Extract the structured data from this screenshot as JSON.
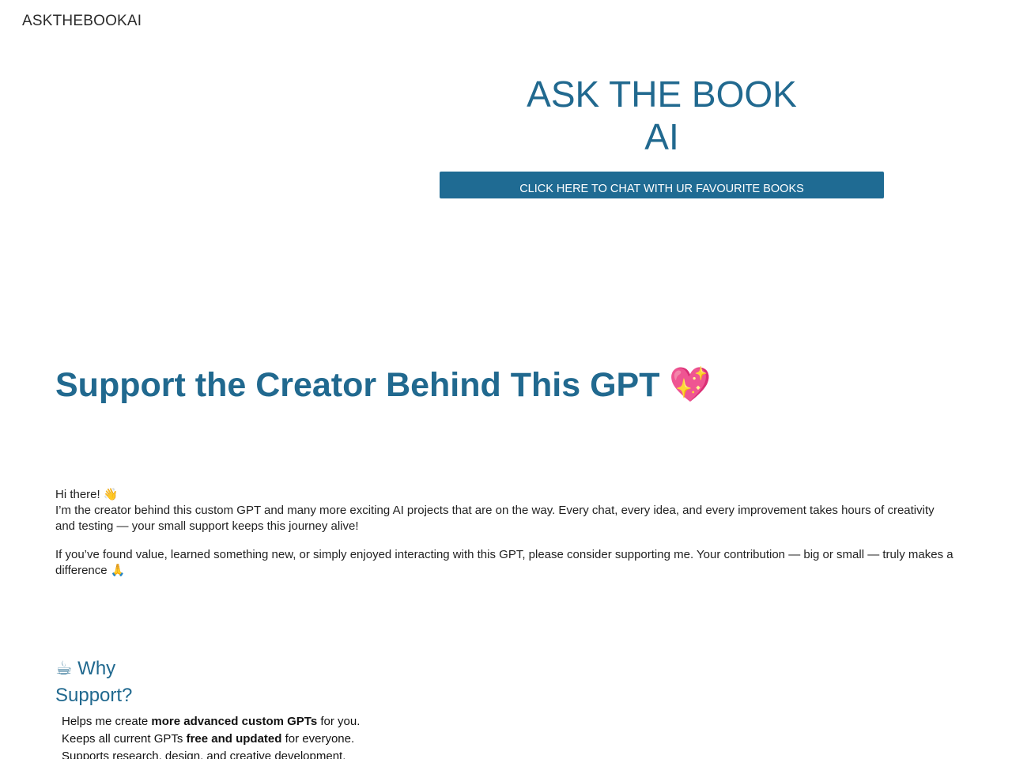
{
  "site": {
    "name": "ASKTHEBOOKAI"
  },
  "hero": {
    "title_line1": "ASK THE BOOK",
    "title_line2": "AI",
    "cta_label": "CLICK HERE TO CHAT WITH UR FAVOURITE BOOKS"
  },
  "support": {
    "heading": "Support the Creator Behind This GPT 💖",
    "greeting": "Hi there! 👋",
    "para1": "I’m the creator behind this custom GPT and many more exciting AI projects that are on the way. Every chat, every idea, and every improvement takes hours of creativity and testing — your small support keeps this journey alive!",
    "para2": "If you’ve found value, learned something new, or simply enjoyed interacting with this GPT, please consider supporting me. Your contribution — big or small — truly makes a difference 🙏"
  },
  "why": {
    "heading": "☕ Why Support?",
    "items": [
      {
        "pre": "Helps me create ",
        "bold": "more advanced custom GPTs",
        "post": " for you."
      },
      {
        "pre": "Keeps all current GPTs ",
        "bold": "free and updated",
        "post": " for everyone."
      },
      {
        "pre": "Supports research, design, and creative development.",
        "bold": "",
        "post": ""
      }
    ]
  }
}
